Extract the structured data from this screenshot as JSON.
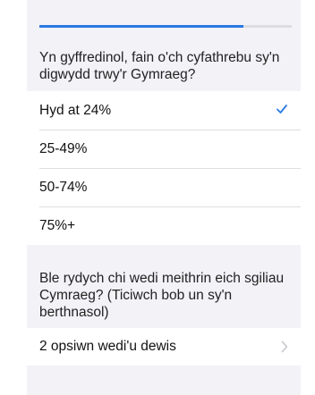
{
  "survey": {
    "progress_fraction": 0.81,
    "accent_color": "#2a7ae2",
    "question_1": {
      "text": "Yn gyffredinol, fain o'ch cyfathrebu sy'n digwydd trwy'r Gymraeg?",
      "options": [
        {
          "label": "Hyd at 24%",
          "selected": true
        },
        {
          "label": "25-49%",
          "selected": false
        },
        {
          "label": "50-74%",
          "selected": false
        },
        {
          "label": "75%+",
          "selected": false
        }
      ]
    },
    "question_2": {
      "text": "Ble rydych chi wedi meithrin eich sgiliau Cymraeg? (Ticiwch bob un sy'n berthnasol)",
      "picker_value": "2 opsiwn wedi'u dewis"
    }
  },
  "icons": {
    "selected_marker": "checkmark-icon",
    "disclosure": "chevron-right-icon"
  }
}
